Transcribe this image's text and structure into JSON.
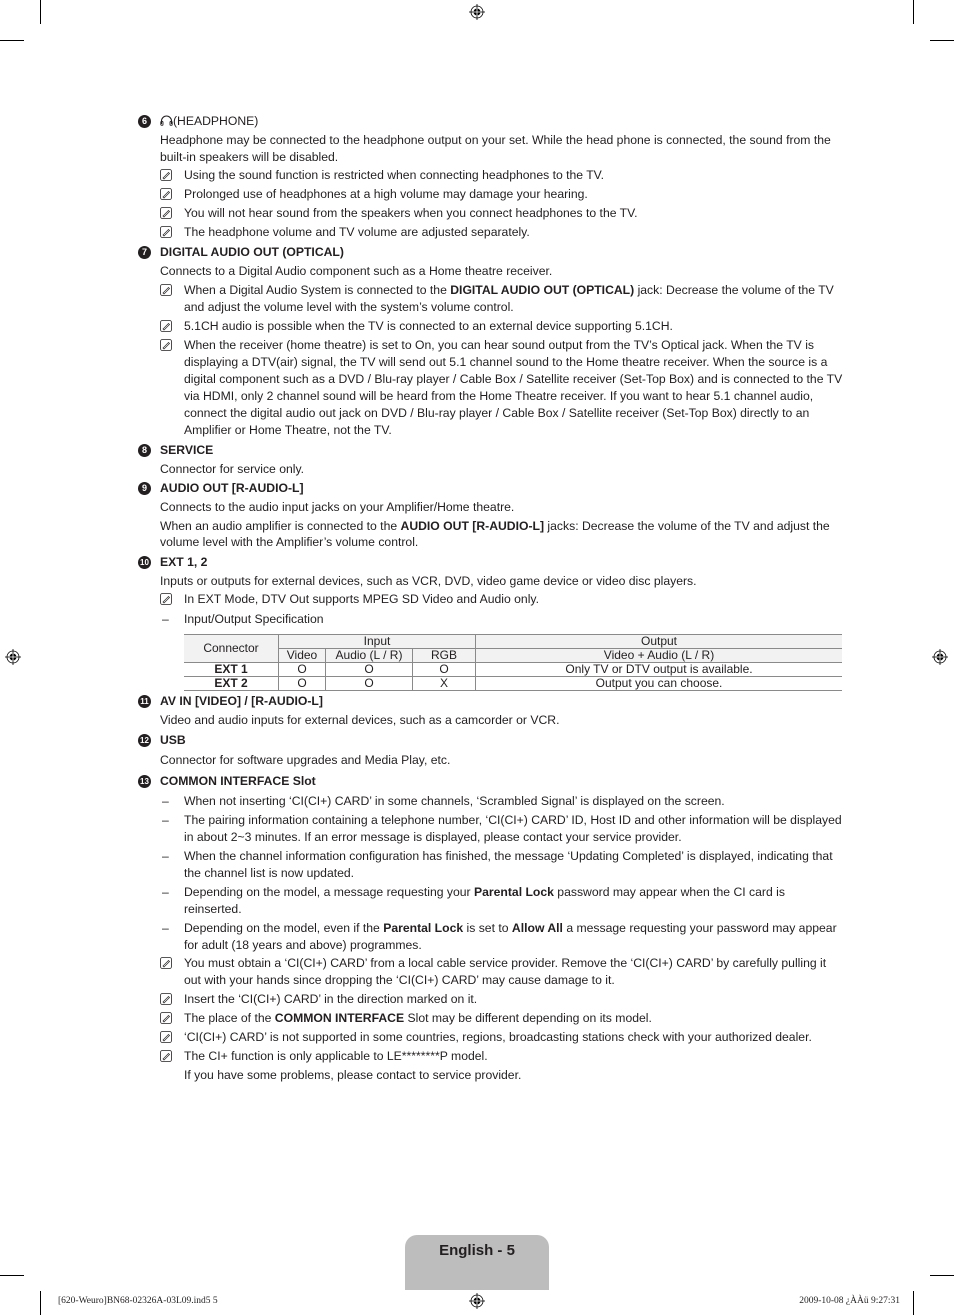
{
  "sections": [
    {
      "number": "6",
      "title": "(HEADPHONE)",
      "icon": "headphone-icon",
      "paragraphs": [
        "Headphone may be connected to the headphone output on your set. While the head phone is connected, the sound from the built-in speakers will be disabled."
      ],
      "notes": [
        "Using the sound function is restricted when connecting headphones to the TV.",
        "Prolonged use of headphones at a high volume may damage your hearing.",
        "You will not hear sound from the speakers when you connect headphones to the TV.",
        "The headphone volume and TV volume are adjusted separately."
      ]
    },
    {
      "number": "7",
      "title": "DIGITAL AUDIO OUT (OPTICAL)",
      "paragraphs": [
        "Connects to a Digital Audio component such as a Home theatre receiver."
      ],
      "notes": [
        {
          "pre": "When a Digital Audio System is connected to the ",
          "bold": "DIGITAL AUDIO OUT (OPTICAL)",
          "post": " jack: Decrease the volume of the TV and adjust the volume level with the system’s volume control."
        },
        "5.1CH audio is possible when the TV is connected to an external device supporting 5.1CH.",
        "When the receiver (home theatre) is set to On, you can hear sound output from the TV’s Optical jack. When the TV is displaying a DTV(air) signal, the TV will send out 5.1 channel sound to the Home theatre receiver. When the source is a digital component such as a DVD / Blu-ray player / Cable Box / Satellite receiver (Set-Top Box) and is connected to the TV via HDMI, only 2 channel sound will be heard from the Home Theatre receiver. If you want to hear 5.1 channel audio, connect the digital audio out jack on DVD / Blu-ray player / Cable Box / Satellite receiver (Set-Top Box) directly to an Amplifier or Home Theatre, not the TV."
      ]
    },
    {
      "number": "8",
      "title": "SERVICE",
      "paragraphs": [
        "Connector for service only."
      ]
    },
    {
      "number": "9",
      "title": "AUDIO OUT [R-AUDIO-L]",
      "paragraphs": [
        "Connects to the audio input jacks on your Amplifier/Home theatre."
      ],
      "rich_paragraph": {
        "pre": "When an audio amplifier is connected to the ",
        "bold": "AUDIO OUT [R-AUDIO-L]",
        "post": " jacks: Decrease the volume of the TV and adjust the volume level with the Amplifier’s volume control."
      }
    },
    {
      "number": "10",
      "title": "EXT 1, 2",
      "paragraphs": [
        "Inputs or outputs for external devices, such as VCR, DVD, video game device or video disc players."
      ],
      "notes": [
        "In EXT Mode, DTV Out supports MPEG SD Video and Audio only."
      ],
      "dash": "Input/Output Specification",
      "table": {
        "col_connector": "Connector",
        "col_input": "Input",
        "col_output": "Output",
        "sub_video": "Video",
        "sub_audio": "Audio (L / R)",
        "sub_rgb": "RGB",
        "sub_output": "Video + Audio (L / R)",
        "rows": [
          {
            "connector": "EXT 1",
            "video": "O",
            "audio": "O",
            "rgb": "O",
            "output": "Only TV or DTV output is available."
          },
          {
            "connector": "EXT 2",
            "video": "O",
            "audio": "O",
            "rgb": "X",
            "output": "Output you can choose."
          }
        ]
      }
    },
    {
      "number": "11",
      "title": "AV IN [VIDEO] / [R-AUDIO-L]",
      "paragraphs": [
        "Video and audio inputs for external devices, such as a camcorder or VCR."
      ]
    },
    {
      "number": "12",
      "title": "USB",
      "paragraphs": [
        "Connector for software upgrades and Media Play, etc."
      ]
    },
    {
      "number": "13",
      "title": "COMMON INTERFACE Slot",
      "dashes": [
        "When not inserting ‘CI(CI+) CARD’ in some channels, ‘Scrambled Signal’ is displayed on the screen.",
        "The pairing information containing a telephone number, ‘CI(CI+) CARD’ ID, Host ID and other information will be displayed in about 2~3 minutes. If an error message is displayed, please contact your service provider.",
        "When the channel information configuration has finished, the message ‘Updating Completed’ is displayed, indicating that the channel list is now updated."
      ],
      "dash_rich_1": {
        "pre": "Depending on the model, a message requesting your ",
        "bold": "Parental Lock",
        "post": " password may appear when the CI card is reinserted."
      },
      "dash_rich_2": {
        "pre": "Depending on the model, even if the ",
        "bold": "Parental Lock",
        "mid": " is set to ",
        "bold2": "Allow All",
        "post": " a message requesting your password may appear for adult (18 years and above) programmes."
      },
      "notes": [
        "You must obtain a ‘CI(CI+) CARD’ from a local cable service provider. Remove the ‘CI(CI+) CARD’ by carefully pulling it out with your hands since dropping the ‘CI(CI+) CARD’ may cause damage to it.",
        "Insert the ‘CI(CI+) CARD’ in the direction marked on it."
      ],
      "note_rich": {
        "pre": "The place of the ",
        "bold": "COMMON INTERFACE",
        "post": " Slot may be different depending on its model."
      },
      "notes_after": [
        "‘CI(CI+) CARD’ is not supported in some countries, regions, broadcasting stations check with your authorized dealer.",
        "The CI+ function is only applicable to LE********P model."
      ],
      "closing": "If you have some problems, please contact to service provider."
    }
  ],
  "footer": {
    "page_label": "English - 5",
    "slug_left": "[620-Weuro]BN68-02326A-03L09.ind5   5",
    "slug_right": "2009-10-08   ¿ÀÀü 9:27:31"
  }
}
